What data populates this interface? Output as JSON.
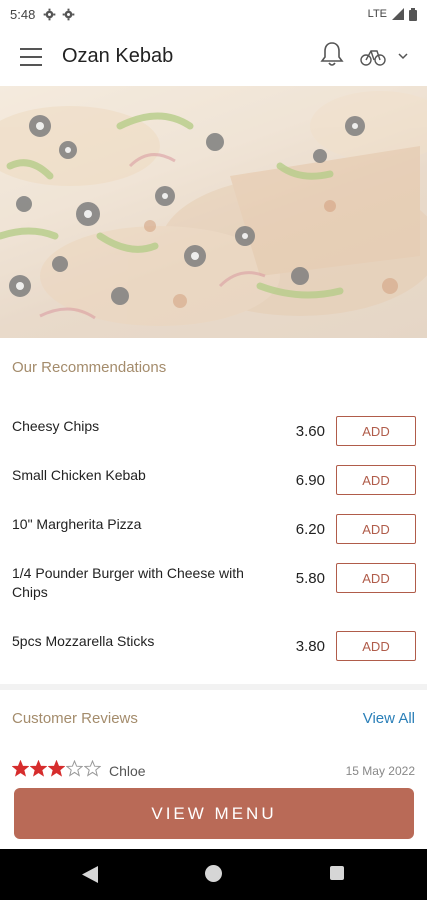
{
  "status_bar": {
    "time": "5:48",
    "network": "LTE"
  },
  "app_bar": {
    "title": "Ozan Kebab"
  },
  "recommendations": {
    "title": "Our Recommendations",
    "add_label": "ADD",
    "items": [
      {
        "name": "Cheesy Chips",
        "price": "3.60"
      },
      {
        "name": "Small Chicken Kebab",
        "price": "6.90"
      },
      {
        "name": "10\" Margherita Pizza",
        "price": "6.20"
      },
      {
        "name": "1/4 Pounder Burger with Cheese with Chips",
        "price": "5.80"
      },
      {
        "name": "5pcs Mozzarella Sticks",
        "price": "3.80"
      }
    ]
  },
  "reviews": {
    "title": "Customer Reviews",
    "view_all_label": "View All",
    "items": [
      {
        "name": "Chloe",
        "date": "15 May 2022",
        "rating": 3,
        "max_rating": 5
      }
    ]
  },
  "cta": {
    "label": "VIEW MENU"
  },
  "colors": {
    "accent": "#b96a57",
    "section_title": "#a48c6c",
    "link": "#2a7fb8",
    "star_filled": "#d62d2d"
  }
}
